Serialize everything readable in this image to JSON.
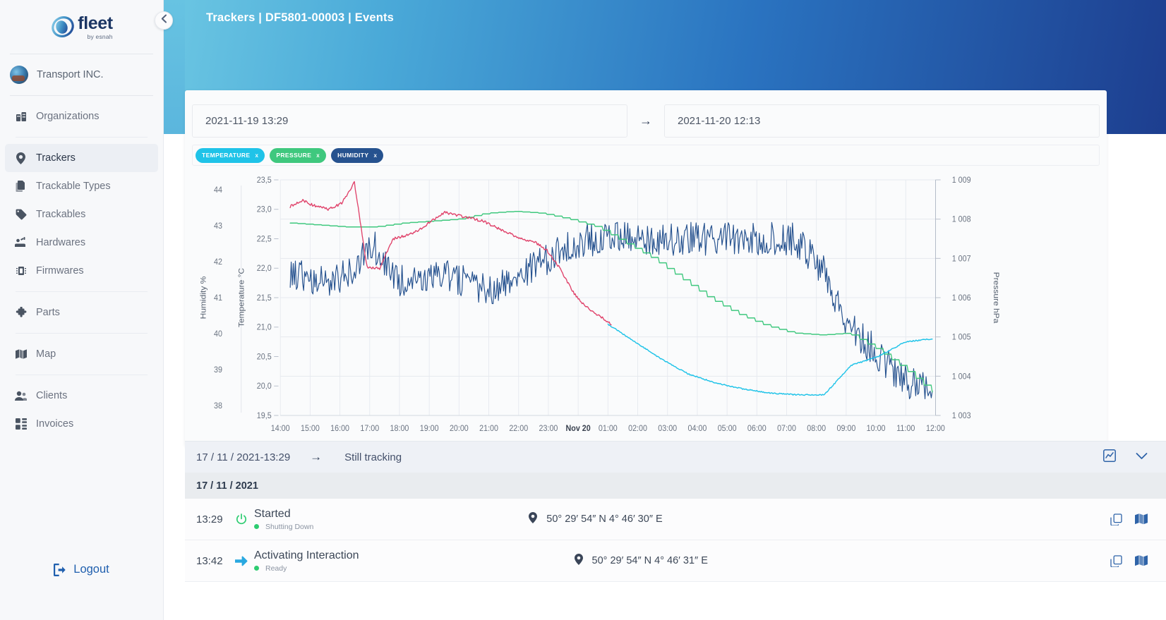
{
  "brand": {
    "name": "fleet",
    "tagline": "by esnah",
    "logo_icon": "fleet-droplet-logo"
  },
  "sidebar": {
    "org": {
      "name": "Transport INC.",
      "avatar_icon": "organization-avatar"
    },
    "groups": [
      {
        "items": [
          {
            "label": "Organizations",
            "icon": "organizations-icon",
            "active": false
          }
        ]
      },
      {
        "items": [
          {
            "label": "Trackers",
            "icon": "map-pin-icon",
            "active": true
          },
          {
            "label": "Trackable Types",
            "icon": "copy-icon",
            "active": false
          },
          {
            "label": "Trackables",
            "icon": "tag-icon",
            "active": false
          },
          {
            "label": "Hardwares",
            "icon": "hardware-icon",
            "active": false
          },
          {
            "label": "Firmwares",
            "icon": "chip-icon",
            "active": false
          }
        ]
      },
      {
        "items": [
          {
            "label": "Parts",
            "icon": "parts-icon",
            "active": false
          }
        ]
      },
      {
        "items": [
          {
            "label": "Map",
            "icon": "map-icon",
            "active": false
          }
        ]
      },
      {
        "items": [
          {
            "label": "Clients",
            "icon": "users-icon",
            "active": false
          },
          {
            "label": "Invoices",
            "icon": "invoice-icon",
            "active": false
          }
        ]
      }
    ],
    "logout": {
      "label": "Logout",
      "icon": "logout-icon"
    },
    "collapse": {
      "icon": "chevron-left-icon"
    }
  },
  "header": {
    "breadcrumb": "Trackers | DF5801-00003 | Events"
  },
  "filters": {
    "start": {
      "value": "2021-11-19 13:29",
      "placeholder": "Start date"
    },
    "end": {
      "value": "2021-11-20 12:13",
      "placeholder": "End date"
    },
    "arrow_icon": "arrow-right-icon",
    "chips": [
      {
        "label": "TEMPERATURE",
        "color": "#1fc3e8",
        "remove": "x"
      },
      {
        "label": "PRESSURE",
        "color": "#3fc87e",
        "remove": "x"
      },
      {
        "label": "HUMIDITY",
        "color": "#26528f",
        "remove": "x"
      }
    ]
  },
  "chart_data": {
    "type": "line",
    "title": "",
    "xlabel": "",
    "grid": true,
    "legend_position": "top-left-chips",
    "x_ticks": [
      "14:00",
      "15:00",
      "16:00",
      "17:00",
      "18:00",
      "19:00",
      "20:00",
      "21:00",
      "22:00",
      "23:00",
      "Nov 20",
      "01:00",
      "02:00",
      "03:00",
      "04:00",
      "05:00",
      "06:00",
      "07:00",
      "08:00",
      "09:00",
      "10:00",
      "11:00",
      "12:00"
    ],
    "x_tick_bold": [
      "Nov 20"
    ],
    "axes": [
      {
        "name": "Humidity %",
        "side": "left",
        "ticks": [
          44,
          43,
          42,
          41,
          40,
          39,
          38
        ],
        "ylim": [
          38,
          44
        ],
        "color": "#26528f"
      },
      {
        "name": "Temperature °C",
        "side": "left",
        "ticks": [
          "23,5",
          "23,0",
          "22,5",
          "22,0",
          "21,5",
          "21,0",
          "20,5",
          "20,0",
          "19,5"
        ],
        "ylim": [
          19.5,
          23.5
        ],
        "color": "#e0436b"
      },
      {
        "name": "Pressure hPa",
        "side": "right",
        "ticks": [
          "1 009",
          "1 008",
          "1 007",
          "1 006",
          "1 005",
          "1 004",
          "1 003"
        ],
        "ylim": [
          1003,
          1009
        ],
        "color": "#3fc87e"
      }
    ],
    "series": [
      {
        "name": "Temperature",
        "axis": "Temperature °C",
        "color": "#e0436b",
        "x": [
          "13:29",
          "14:00",
          "14:30",
          "15:00",
          "15:30",
          "16:00",
          "16:10",
          "16:20",
          "16:30",
          "17:00",
          "17:30",
          "18:00",
          "18:30",
          "19:00",
          "19:30",
          "20:00",
          "20:30",
          "21:00",
          "21:30",
          "22:00",
          "22:30",
          "23:00",
          "23:30",
          "00:00",
          "00:30",
          "01:00",
          "02:00",
          "03:00",
          "04:00",
          "05:00",
          "06:00",
          "07:00",
          "08:00",
          "09:00",
          "10:00",
          "11:00",
          "12:00"
        ],
        "values": [
          23.05,
          23.15,
          23.05,
          23.0,
          23.1,
          23.45,
          22.0,
          22.0,
          22.5,
          22.55,
          22.65,
          22.8,
          22.95,
          22.9,
          22.85,
          22.8,
          22.7,
          22.6,
          22.5,
          22.45,
          22.3,
          22.0,
          21.6,
          21.35,
          21.2,
          21.05,
          null,
          null,
          null,
          null,
          null,
          null,
          null,
          null,
          null,
          null,
          null
        ]
      },
      {
        "name": "Pressure",
        "axis": "Pressure hPa",
        "color": "#3fc87e",
        "x": [
          "13:29",
          "14:00",
          "15:00",
          "16:00",
          "17:00",
          "18:00",
          "19:00",
          "20:00",
          "21:00",
          "22:00",
          "23:00",
          "00:00",
          "01:00",
          "02:00",
          "03:00",
          "04:00",
          "05:00",
          "06:00",
          "07:00",
          "08:00",
          "09:00",
          "10:00",
          "11:00",
          "12:00"
        ],
        "values": [
          1007.9,
          1007.85,
          1007.8,
          1007.8,
          1007.9,
          1007.95,
          1008.0,
          1008.15,
          1008.2,
          1008.15,
          1008.0,
          1007.8,
          1007.4,
          1007.0,
          1006.5,
          1006.0,
          1005.6,
          1005.3,
          1005.1,
          1005.05,
          1005.1,
          1004.7,
          1004.2,
          1003.6
        ]
      },
      {
        "name": "Humidity",
        "axis": "Humidity %",
        "color": "#26528f",
        "x": [
          "13:29",
          "14:00",
          "15:00",
          "16:00",
          "17:00",
          "18:00",
          "19:00",
          "20:00",
          "21:00",
          "22:00",
          "23:00",
          "00:00",
          "01:00",
          "02:00",
          "03:00",
          "04:00",
          "05:00",
          "06:00",
          "07:00",
          "08:00",
          "09:00",
          "10:00",
          "11:00",
          "12:00"
        ],
        "values": [
          41.6,
          41.4,
          41.6,
          42.3,
          41.4,
          41.6,
          41.5,
          41.2,
          41.4,
          41.9,
          42.4,
          42.5,
          42.5,
          42.5,
          42.5,
          42.5,
          42.5,
          42.5,
          42.5,
          41.8,
          40.3,
          39.6,
          38.9,
          38.6
        ]
      },
      {
        "name": "Temperature (cyan segment)",
        "axis": "Temperature °C",
        "color": "#1fc3e8",
        "x": [
          "01:00",
          "02:00",
          "03:00",
          "04:00",
          "05:00",
          "06:00",
          "07:00",
          "08:00",
          "09:00",
          "09:30",
          "10:00",
          "11:00",
          "12:00"
        ],
        "values": [
          21.05,
          20.75,
          20.45,
          20.2,
          20.05,
          19.95,
          19.88,
          19.85,
          19.85,
          20.35,
          20.5,
          20.75,
          20.8
        ]
      }
    ]
  },
  "summary": {
    "date": "17 / 11 / 2021-13:29",
    "arrow_icon": "arrow-right-icon",
    "status": "Still tracking",
    "chart_icon": "analytics-icon",
    "collapse_icon": "chevron-down-icon"
  },
  "day_header": "17 / 11 / 2021",
  "events": [
    {
      "time": "13:29",
      "icon": "power-icon",
      "icon_color": "#2ecc71",
      "title": "Started",
      "sub_label": "Shutting Down",
      "sub_dot_color": "#2ecc71",
      "location_icon": "map-pin-icon",
      "coordinates": "50° 29′ 54″ N  4° 46′ 30″ E",
      "actions": [
        {
          "icon": "copy-icon"
        },
        {
          "icon": "map-icon"
        }
      ]
    },
    {
      "time": "13:42",
      "icon": "arrow-right-filled-icon",
      "icon_color": "#29a8e0",
      "title": "Activating Interaction",
      "sub_label": "Ready",
      "sub_dot_color": "#2ecc71",
      "location_icon": "map-pin-icon",
      "coordinates": "50° 29′ 54″ N  4° 46′ 31″ E",
      "actions": [
        {
          "icon": "copy-icon"
        },
        {
          "icon": "map-icon"
        }
      ]
    }
  ]
}
